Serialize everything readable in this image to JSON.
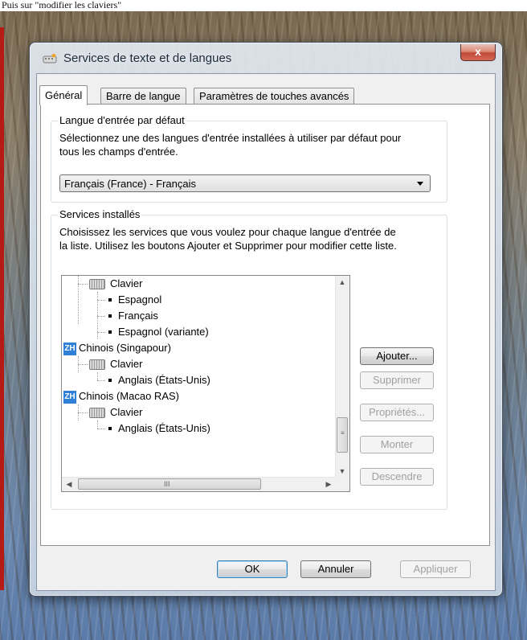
{
  "caption": "Puis sur \"modifier les claviers\"",
  "window": {
    "title": "Services de texte et de langues",
    "close_label": "x"
  },
  "tabs": [
    {
      "label": "Général",
      "active": true
    },
    {
      "label": "Barre de langue",
      "active": false
    },
    {
      "label": "Paramètres de touches avancés",
      "active": false
    }
  ],
  "default_language": {
    "group_title": "Langue d'entrée par défaut",
    "description_line1": "Sélectionnez une des langues d'entrée installées à utiliser par défaut pour",
    "description_line2": "tous les champs d'entrée.",
    "selected": "Français (France) - Français"
  },
  "services": {
    "group_title": "Services installés",
    "description_line1": "Choisissez les services que vous voulez pour chaque langue d'entrée de",
    "description_line2": "la liste. Utilisez les boutons Ajouter et Supprimer pour modifier cette liste.",
    "tree": [
      {
        "type": "category",
        "label": "Clavier"
      },
      {
        "type": "item",
        "label": "Espagnol"
      },
      {
        "type": "item",
        "label": "Français"
      },
      {
        "type": "item",
        "label": "Espagnol (variante)"
      },
      {
        "type": "language",
        "badge": "ZH",
        "label": "Chinois (Singapour)"
      },
      {
        "type": "category",
        "label": "Clavier"
      },
      {
        "type": "item",
        "label": "Anglais (États-Unis)"
      },
      {
        "type": "language",
        "badge": "ZH",
        "label": "Chinois (Macao RAS)"
      },
      {
        "type": "category",
        "label": "Clavier"
      },
      {
        "type": "item",
        "label": "Anglais (États-Unis)"
      }
    ],
    "buttons": {
      "add": "Ajouter...",
      "remove": "Supprimer",
      "properties": "Propriétés...",
      "move_up": "Monter",
      "move_down": "Descendre"
    }
  },
  "footer": {
    "ok": "OK",
    "cancel": "Annuler",
    "apply": "Appliquer"
  }
}
